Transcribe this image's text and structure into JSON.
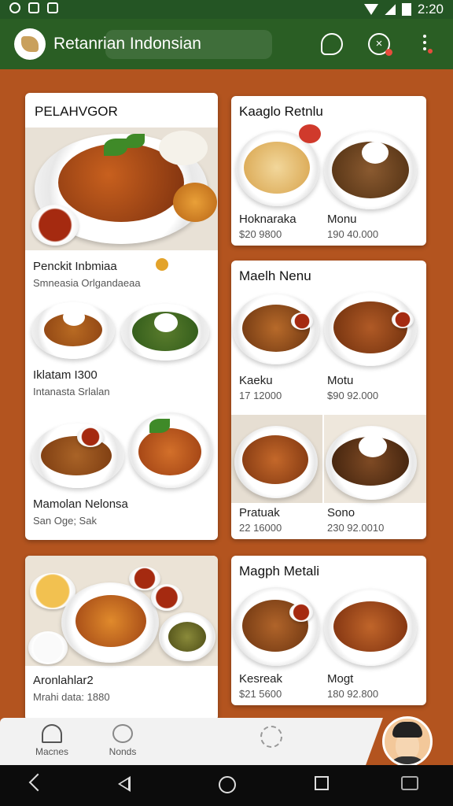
{
  "status_bar": {
    "time": "2:20"
  },
  "app_bar": {
    "title": "Retanrian Indonsian"
  },
  "cards": {
    "featured": {
      "title": "PELAHVGOR",
      "items": [
        {
          "name": "Penckit Inbmiaa",
          "detail": "Smneasia Orlgandaeaa"
        },
        {
          "name": "Iklatam I300",
          "detail": "Intanasta Srlalan"
        },
        {
          "name": "Mamolan Nelonsa",
          "detail": "San Oge; Sak"
        }
      ]
    },
    "top_right": {
      "title": "Kaaglo Retnlu",
      "items": [
        {
          "name": "Hoknaraka",
          "price": "$20 9800"
        },
        {
          "name": "Monu",
          "price": "190 40.000"
        }
      ]
    },
    "mid_right": {
      "title": "Maelh Nenu",
      "items": [
        {
          "name": "Kaeku",
          "price": "17 12000"
        },
        {
          "name": "Motu",
          "price": "$90 92.000"
        },
        {
          "name": "Pratuak",
          "price": "22 16000"
        },
        {
          "name": "Sono",
          "price": "230 92.0010"
        }
      ]
    },
    "bottom_left": {
      "name": "Aronlahlar2",
      "detail": "Mrahi data: 1880"
    },
    "bottom_right": {
      "title": "Magph Metali",
      "items": [
        {
          "name": "Kesreak",
          "price": "$21 5600"
        },
        {
          "name": "Mogt",
          "price": "180 92.800"
        }
      ]
    }
  },
  "bottom_nav": {
    "items": [
      {
        "label": "Macnes",
        "icon": "home-icon"
      },
      {
        "label": "Nonds",
        "icon": "person-icon"
      }
    ]
  },
  "colors": {
    "background": "#b3541f",
    "app_bar": "#2a5e24",
    "card": "#ffffff"
  }
}
